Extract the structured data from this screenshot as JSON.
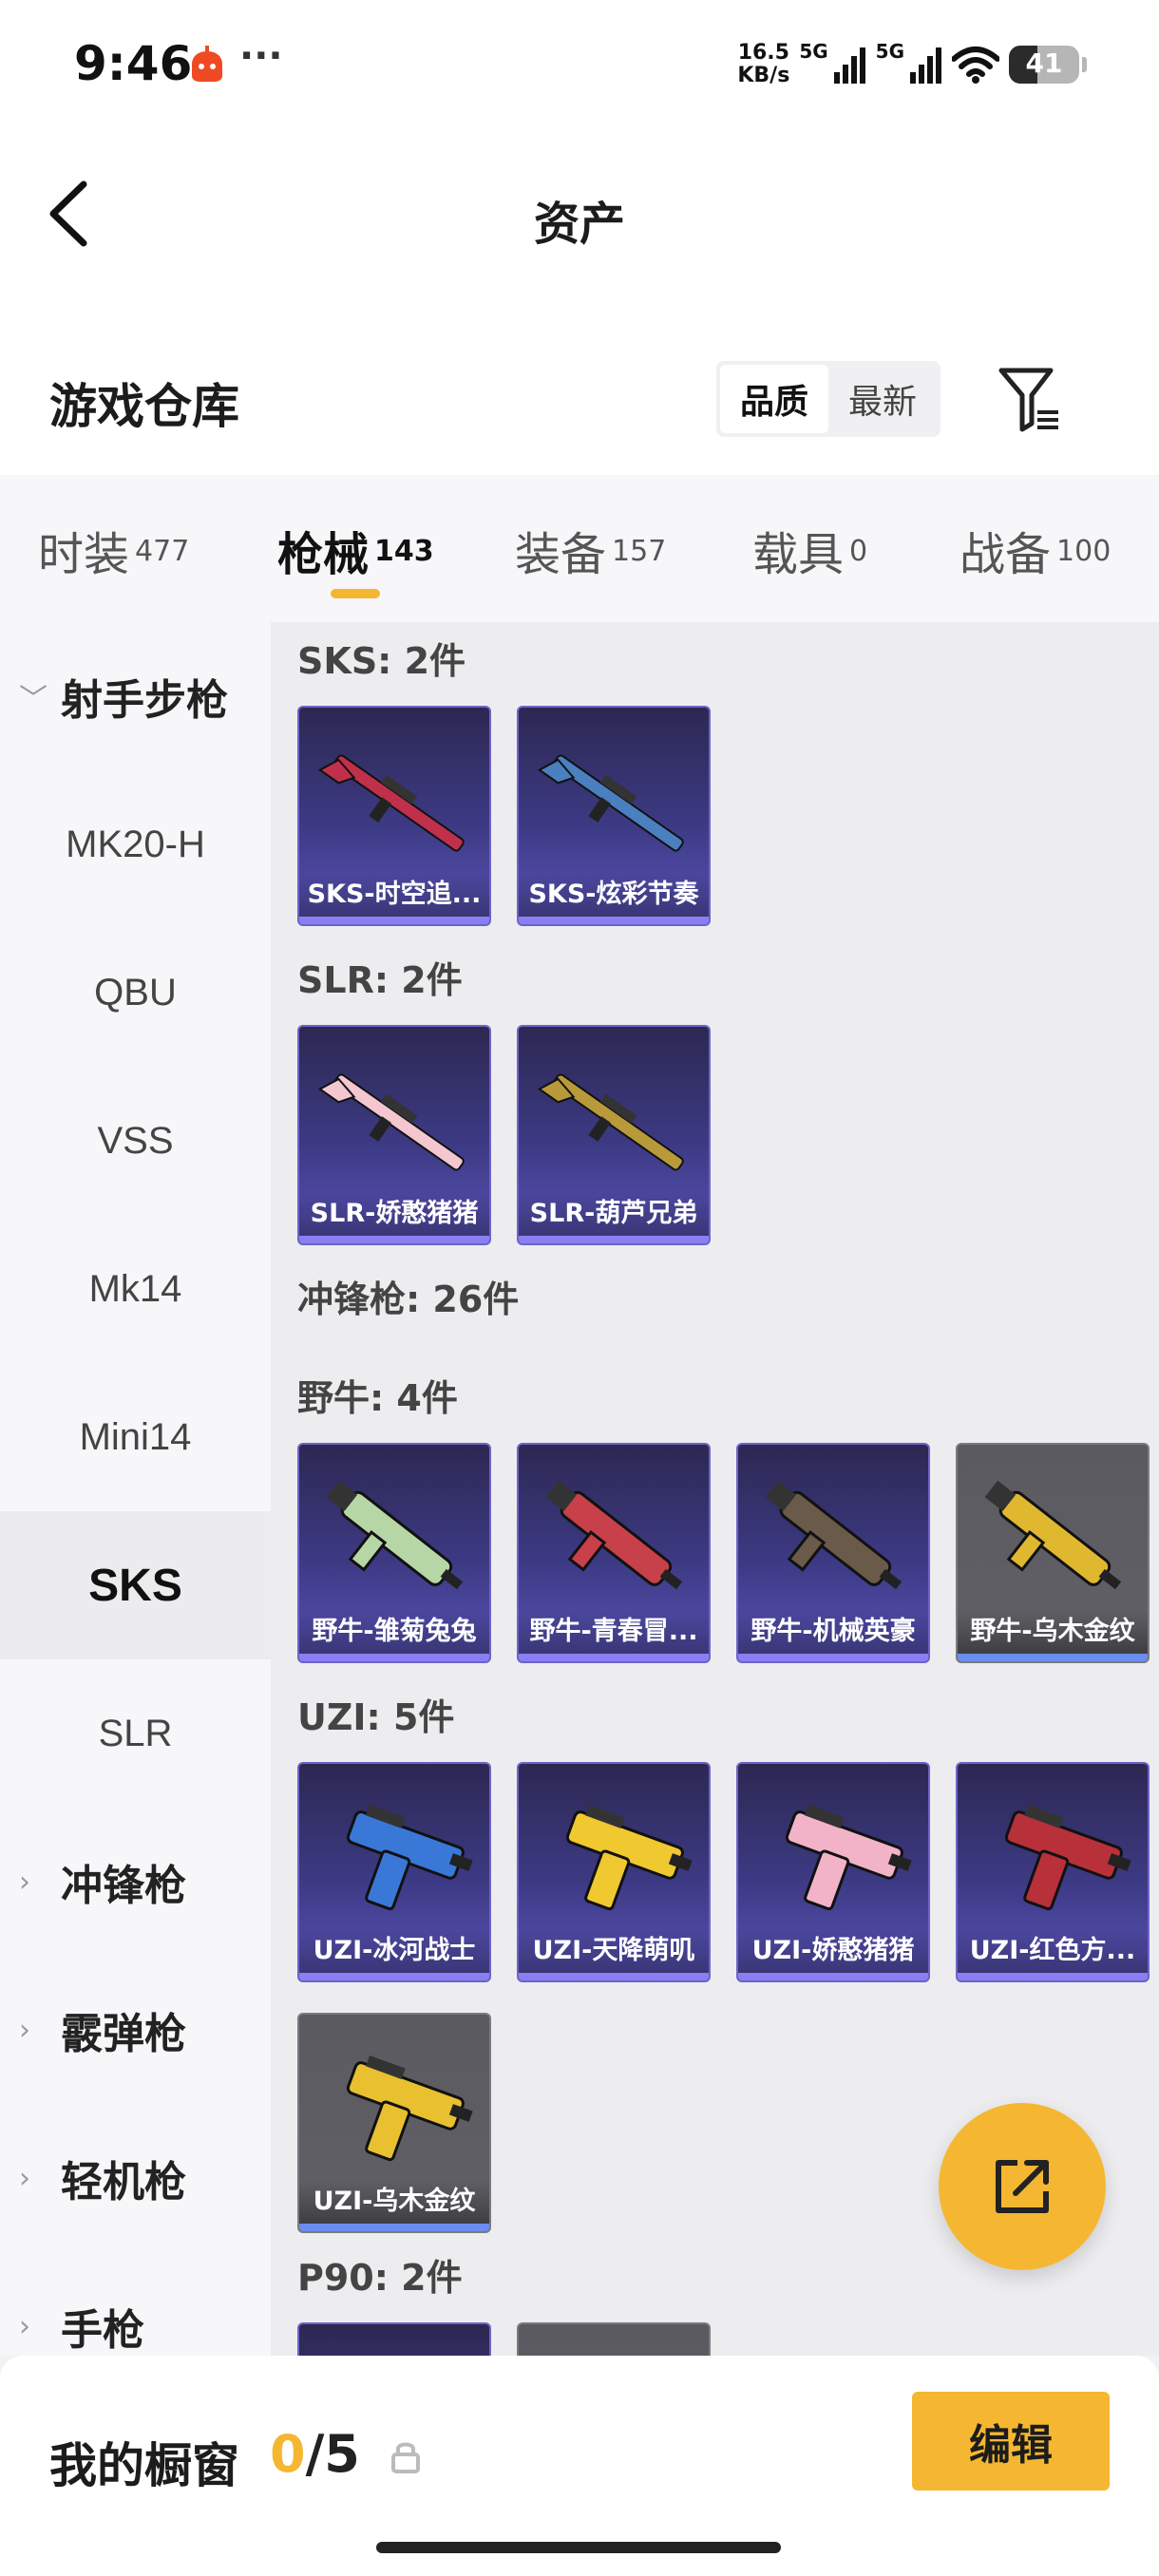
{
  "status_bar": {
    "time": "9:46",
    "speed_value": "16.5",
    "speed_unit": "KB/s",
    "net_1": "5G",
    "net_2": "5G",
    "battery": "41",
    "battery_level": 0.41
  },
  "nav": {
    "title": "资产"
  },
  "warehouse": {
    "title": "游戏仓库",
    "sort_options": [
      "品质",
      "最新"
    ],
    "sort_selected": "品质"
  },
  "category_tabs": [
    {
      "name": "时装",
      "count": "477"
    },
    {
      "name": "枪械",
      "count": "143"
    },
    {
      "name": "装备",
      "count": "157"
    },
    {
      "name": "载具",
      "count": "0"
    },
    {
      "name": "战备",
      "count": "100"
    }
  ],
  "active_category": "枪械",
  "sidebar": {
    "items": [
      {
        "label": "射手步枪",
        "type": "group",
        "expanded": true
      },
      {
        "label": "MK20-H",
        "type": "sub"
      },
      {
        "label": "QBU",
        "type": "sub"
      },
      {
        "label": "VSS",
        "type": "sub"
      },
      {
        "label": "Mk14",
        "type": "sub"
      },
      {
        "label": "Mini14",
        "type": "sub"
      },
      {
        "label": "SKS",
        "type": "sub",
        "selected": true
      },
      {
        "label": "SLR",
        "type": "sub"
      },
      {
        "label": "冲锋枪",
        "type": "group",
        "expanded": false
      },
      {
        "label": "霰弹枪",
        "type": "group",
        "expanded": false
      },
      {
        "label": "轻机枪",
        "type": "group",
        "expanded": false
      },
      {
        "label": "手枪",
        "type": "group",
        "expanded": false
      }
    ]
  },
  "content": {
    "sections": [
      {
        "title": "SKS: 2件",
        "items": [
          {
            "label": "SKS-时空追...",
            "rarity": "purple",
            "icon": "rifle-icon",
            "color": "#c0304a"
          },
          {
            "label": "SKS-炫彩节奏",
            "rarity": "purple",
            "icon": "rifle-icon",
            "color": "#4a7fc0"
          }
        ]
      },
      {
        "title": "SLR: 2件",
        "items": [
          {
            "label": "SLR-娇憨猪猪",
            "rarity": "purple",
            "icon": "rifle-icon",
            "color": "#f4c6d0"
          },
          {
            "label": "SLR-葫芦兄弟",
            "rarity": "purple",
            "icon": "rifle-icon",
            "color": "#b89a3a"
          }
        ]
      },
      {
        "title": "冲锋枪: 26件",
        "items": []
      },
      {
        "title": "野牛: 4件",
        "items": [
          {
            "label": "野牛-雏菊兔兔",
            "rarity": "purple",
            "icon": "smg-icon",
            "color": "#b7d6a6"
          },
          {
            "label": "野牛-青春冒...",
            "rarity": "purple",
            "icon": "smg-icon",
            "color": "#c8404a"
          },
          {
            "label": "野牛-机械英豪",
            "rarity": "purple",
            "icon": "smg-icon",
            "color": "#6a5a4a"
          },
          {
            "label": "野牛-乌木金纹",
            "rarity": "grey",
            "icon": "smg-icon",
            "color": "#e0b830"
          }
        ]
      },
      {
        "title": "UZI: 5件",
        "items": [
          {
            "label": "UZI-冰河战士",
            "rarity": "purple",
            "icon": "pistol-smg-icon",
            "color": "#3a78d8"
          },
          {
            "label": "UZI-天降萌叽",
            "rarity": "purple",
            "icon": "pistol-smg-icon",
            "color": "#f0c830"
          },
          {
            "label": "UZI-娇憨猪猪",
            "rarity": "purple",
            "icon": "pistol-smg-icon",
            "color": "#f2b2c8"
          },
          {
            "label": "UZI-红色方...",
            "rarity": "purple",
            "icon": "pistol-smg-icon",
            "color": "#b8303a"
          },
          {
            "label": "UZI-乌木金纹",
            "rarity": "grey",
            "icon": "pistol-smg-icon",
            "color": "#e8c030"
          }
        ]
      },
      {
        "title": "P90: 2件",
        "items": [
          {
            "label": "",
            "rarity": "purple",
            "icon": "smg-icon",
            "color": "#333"
          },
          {
            "label": "",
            "rarity": "grey",
            "icon": "smg-icon",
            "color": "#333"
          }
        ]
      }
    ]
  },
  "showcase": {
    "title": "我的橱窗",
    "current": "0",
    "total": "/5",
    "edit_label": "编辑"
  },
  "colors": {
    "accent": "#f5b731",
    "card_purple": "#3d3a85",
    "card_grey": "#5a5a60"
  }
}
